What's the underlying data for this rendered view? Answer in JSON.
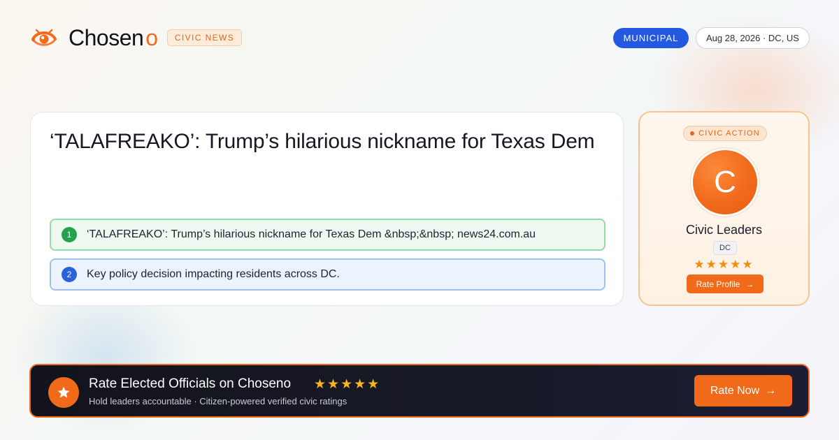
{
  "brand": {
    "name": "Choseno",
    "name_main": "Chosen",
    "name_accent": "o",
    "tag": "CIVIC NEWS",
    "accent_color": "#f26b1d"
  },
  "header": {
    "category": "MUNICIPAL",
    "date_location": "Aug 28, 2026 · DC, US"
  },
  "article": {
    "headline": "‘TALAFREAKO’: Trump’s hilarious nickname for Texas Dem",
    "points": [
      {
        "num": "1",
        "text": "‘TALAFREAKO’: Trump’s hilarious nickname for Texas Dem &nbsp;&nbsp; news24.com.au"
      },
      {
        "num": "2",
        "text": "Key policy decision impacting residents across DC."
      }
    ]
  },
  "side": {
    "tag": "CIVIC ACTION",
    "avatar_letter": "C",
    "name": "Civic Leaders",
    "location": "DC",
    "stars": "★★★★★",
    "rating": 5,
    "button": "Rate Profile",
    "button_arrow": "→"
  },
  "banner": {
    "icon": "star-icon",
    "title": "Rate Elected Officials on Choseno",
    "stars": "★★★★★",
    "subtitle": "Hold leaders accountable · Citizen-powered verified civic ratings",
    "button": "Rate Now",
    "button_arrow": "→",
    "border_color": "#ee6a1e"
  }
}
